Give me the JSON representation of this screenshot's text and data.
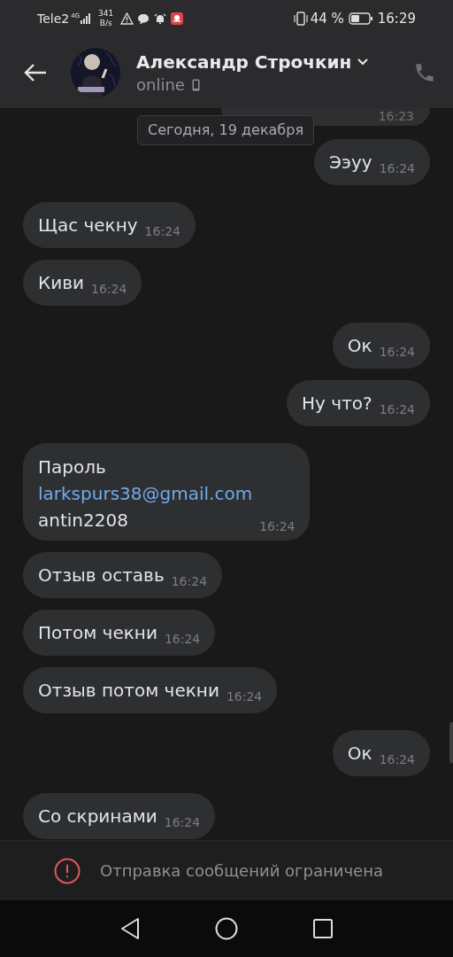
{
  "status_bar": {
    "carrier": "Tele2",
    "network": "4G",
    "speed_value": "341",
    "speed_unit": "B/s",
    "battery": "44 %",
    "time": "16:29"
  },
  "header": {
    "name": "Александр Строчкин",
    "status": "online"
  },
  "date_chip": "Сегодня, 19 декабря",
  "messages": [
    {
      "kind": "cut",
      "outgoing": true,
      "time": "16:23"
    },
    {
      "kind": "text",
      "outgoing": true,
      "lines": [
        {
          "kind": "text",
          "text": "Ээуу"
        }
      ],
      "time": "16:24"
    },
    {
      "kind": "text",
      "outgoing": false,
      "lines": [
        {
          "kind": "text",
          "text": "Щас чекну"
        }
      ],
      "time": "16:24"
    },
    {
      "kind": "text",
      "outgoing": false,
      "lines": [
        {
          "kind": "text",
          "text": "Киви"
        }
      ],
      "time": "16:24"
    },
    {
      "kind": "text",
      "outgoing": true,
      "lines": [
        {
          "kind": "text",
          "text": "Ок"
        }
      ],
      "time": "16:24"
    },
    {
      "kind": "text",
      "outgoing": true,
      "lines": [
        {
          "kind": "text",
          "text": "Ну что?"
        }
      ],
      "time": "16:24"
    },
    {
      "kind": "text",
      "outgoing": false,
      "lines": [
        {
          "kind": "text",
          "text": "Пароль"
        },
        {
          "kind": "link",
          "text": "larkspurs38@gmail.com"
        },
        {
          "kind": "text",
          "text": "antin2208"
        }
      ],
      "time": "16:24"
    },
    {
      "kind": "text",
      "outgoing": false,
      "lines": [
        {
          "kind": "text",
          "text": "Отзыв оставь"
        }
      ],
      "time": "16:24"
    },
    {
      "kind": "text",
      "outgoing": false,
      "lines": [
        {
          "kind": "text",
          "text": "Потом чекни"
        }
      ],
      "time": "16:24"
    },
    {
      "kind": "text",
      "outgoing": false,
      "lines": [
        {
          "kind": "text",
          "text": "Отзыв потом чекни"
        }
      ],
      "time": "16:24"
    },
    {
      "kind": "text",
      "outgoing": true,
      "lines": [
        {
          "kind": "text",
          "text": "Ок"
        }
      ],
      "time": "16:24"
    },
    {
      "kind": "text",
      "outgoing": false,
      "lines": [
        {
          "kind": "text",
          "text": "Со скринами"
        }
      ],
      "time": "16:24"
    }
  ],
  "notice": "Отправка сообщений ограничена"
}
